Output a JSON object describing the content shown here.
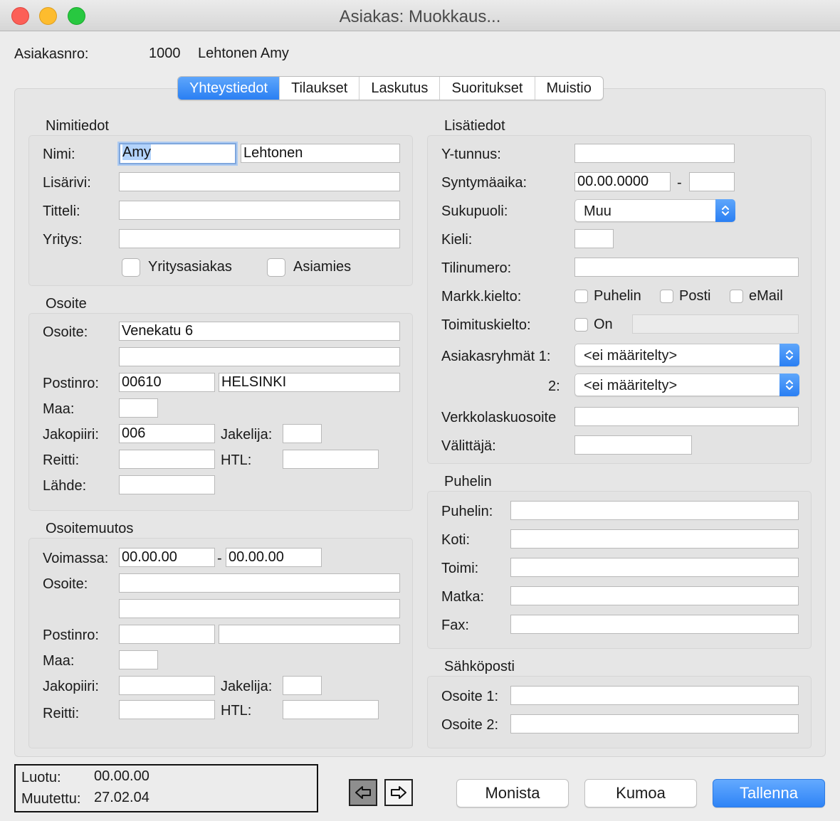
{
  "window": {
    "title": "Asiakas: Muokkaus..."
  },
  "header": {
    "customer_no_label": "Asiakasnro:",
    "customer_no": "1000",
    "customer_name": "Lehtonen Amy"
  },
  "tabs": [
    {
      "label": "Yhteystiedot",
      "active": true
    },
    {
      "label": "Tilaukset"
    },
    {
      "label": "Laskutus"
    },
    {
      "label": "Suoritukset"
    },
    {
      "label": "Muistio"
    }
  ],
  "nimitiedot": {
    "title": "Nimitiedot",
    "nimi_label": "Nimi:",
    "first_name": "Amy",
    "last_name": "Lehtonen",
    "lisarivi_label": "Lisärivi:",
    "lisarivi": "",
    "titteli_label": "Titteli:",
    "titteli": "",
    "yritys_label": "Yritys:",
    "yritys": "",
    "yritysasiakas_label": "Yritysasiakas",
    "yritysasiakas_checked": false,
    "asiamies_label": "Asiamies",
    "asiamies_checked": false
  },
  "osoite": {
    "title": "Osoite",
    "osoite_label": "Osoite:",
    "osoite1": "Venekatu 6",
    "osoite2": "",
    "postinro_label": "Postinro:",
    "postinro": "00610",
    "city": "HELSINKI",
    "maa_label": "Maa:",
    "maa": "",
    "jakopiiri_label": "Jakopiiri:",
    "jakopiiri": "006",
    "jakelija_label": "Jakelija:",
    "jakelija": "",
    "reitti_label": "Reitti:",
    "reitti": "",
    "htl_label": "HTL:",
    "htl": "",
    "lahde_label": "Lähde:",
    "lahde": ""
  },
  "osoitemuutos": {
    "title": "Osoitemuutos",
    "voimassa_label": "Voimassa:",
    "from": "00.00.00",
    "dash": "-",
    "to": "00.00.00",
    "osoite_label": "Osoite:",
    "osoite1": "",
    "osoite2": "",
    "postinro_label": "Postinro:",
    "postinro": "",
    "city": "",
    "maa_label": "Maa:",
    "maa": "",
    "jakopiiri_label": "Jakopiiri:",
    "jakopiiri": "",
    "jakelija_label": "Jakelija:",
    "jakelija": "",
    "reitti_label": "Reitti:",
    "reitti": "",
    "htl_label": "HTL:",
    "htl": ""
  },
  "lisatiedot": {
    "title": "Lisätiedot",
    "ytunnus_label": "Y-tunnus:",
    "ytunnus": "",
    "syntymaaika_label": "Syntymäaika:",
    "syntymaaika": "00.00.0000",
    "dash": "-",
    "syntymaaika_suffix": "",
    "sukupuoli_label": "Sukupuoli:",
    "sukupuoli": "Muu",
    "kieli_label": "Kieli:",
    "kieli": "",
    "tilinumero_label": "Tilinumero:",
    "tilinumero": "",
    "markk_label": "Markk.kielto:",
    "puhelin_label": "Puhelin",
    "posti_label": "Posti",
    "email_label": "eMail",
    "toimitus_label": "Toimituskielto:",
    "on_label": "On",
    "toimitus_text": "",
    "ryhmat_label": "Asiakasryhmät  1:",
    "ryhma1": "<ei määritelty>",
    "ryhma2_label": "2:",
    "ryhma2": "<ei määritelty>",
    "verkko_label": "Verkkolaskuosoite",
    "verkko": "",
    "valittaja_label": "Välittäjä:",
    "valittaja": ""
  },
  "puhelin": {
    "title": "Puhelin",
    "puhelin_label": "Puhelin:",
    "puhelin": "",
    "koti_label": "Koti:",
    "koti": "",
    "toimi_label": "Toimi:",
    "toimi": "",
    "matka_label": "Matka:",
    "matka": "",
    "fax_label": "Fax:",
    "fax": ""
  },
  "sahkoposti": {
    "title": "Sähköposti",
    "osoite1_label": "Osoite 1:",
    "osoite1": "",
    "osoite2_label": "Osoite 2:",
    "osoite2": ""
  },
  "info": {
    "luotu_label": "Luotu:",
    "luotu": "00.00.00",
    "muutettu_label": "Muutettu:",
    "muutettu": "27.02.04"
  },
  "nav": {
    "prev_icon": "arrow-left-icon",
    "next_icon": "arrow-right-icon"
  },
  "buttons": {
    "monista": "Monista",
    "kumoa": "Kumoa",
    "tallenna": "Tallenna"
  }
}
